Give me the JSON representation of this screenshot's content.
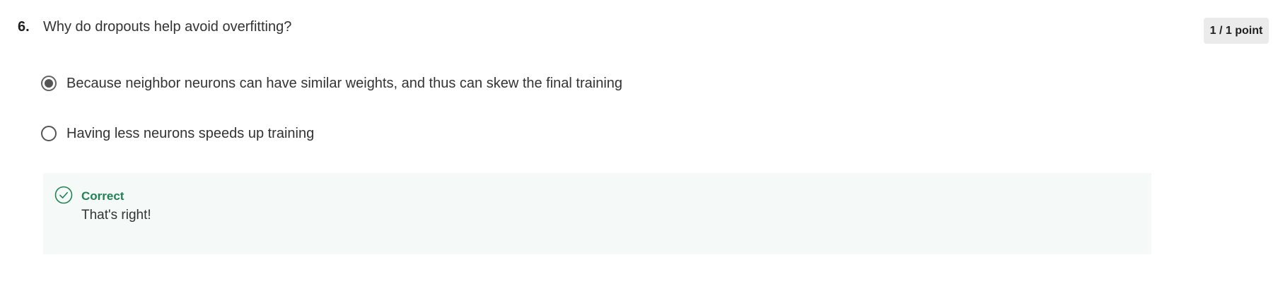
{
  "question": {
    "number": "6.",
    "text": "Why do dropouts help avoid overfitting?",
    "score": "1 / 1 point"
  },
  "options": [
    {
      "label": "Because neighbor neurons can have similar weights, and thus can skew the final training",
      "selected": true
    },
    {
      "label": "Having less neurons speeds up training",
      "selected": false
    }
  ],
  "feedback": {
    "status": "Correct",
    "message": "That's right!",
    "icon": "check-circle-icon",
    "color": "#1f8354",
    "background": "#f5f9f7"
  }
}
